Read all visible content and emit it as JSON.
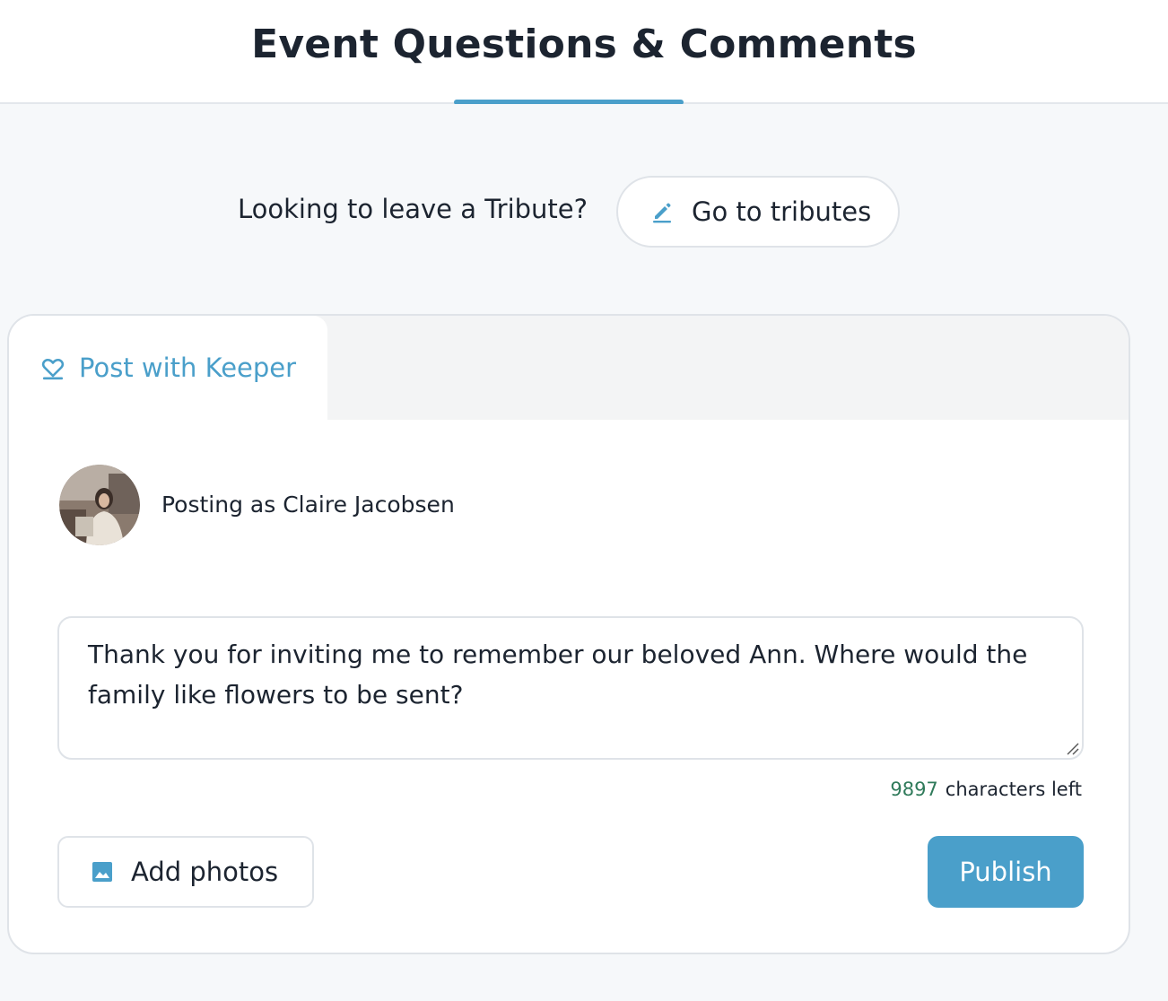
{
  "colors": {
    "accent": "#4a9fca",
    "count_green": "#2f7a5a"
  },
  "header": {
    "title": "Event Questions & Comments"
  },
  "tribute": {
    "prompt": "Looking to leave a Tribute?",
    "button_label": "Go to tributes",
    "button_icon": "pencil-icon"
  },
  "composer": {
    "tab_label": "Post with Keeper",
    "tab_icon": "heart-icon",
    "posting_as": "Posting as Claire Jacobsen",
    "message": "Thank you for inviting me to remember our beloved Ann. Where would the family like flowers to be sent?",
    "chars_left_value": "9897",
    "chars_left_label": "characters left",
    "add_photos_label": "Add photos",
    "add_photos_icon": "image-icon",
    "publish_label": "Publish"
  }
}
